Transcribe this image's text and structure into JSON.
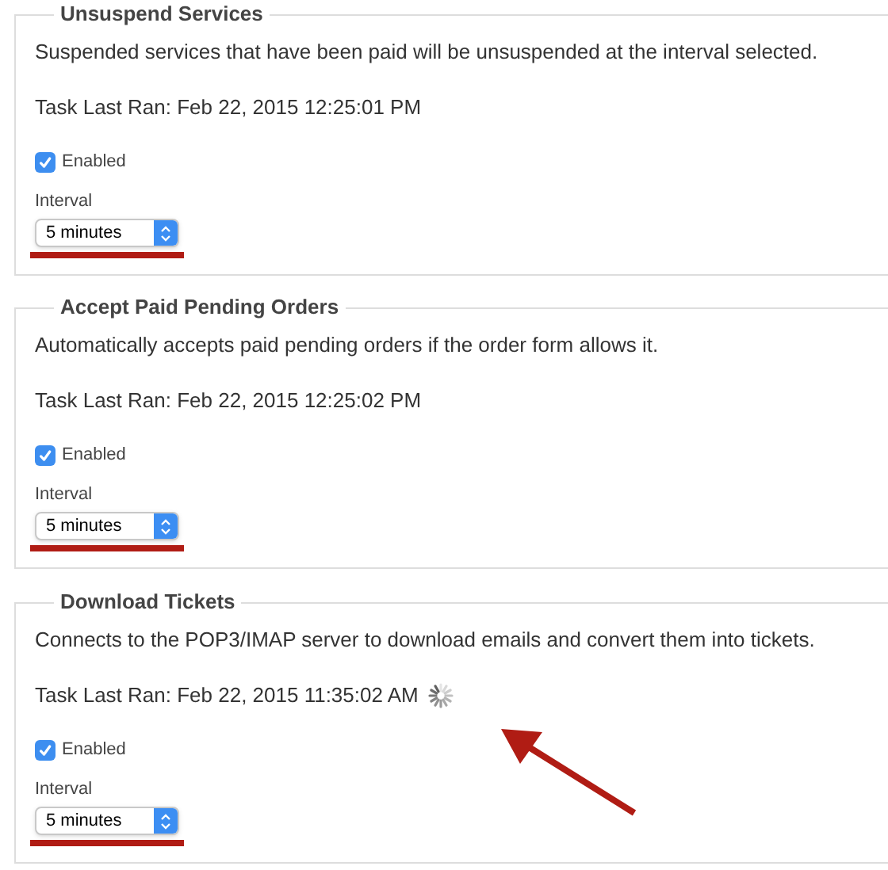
{
  "sections": [
    {
      "title": "Unsuspend Services",
      "description": "Suspended services that have been paid will be unsuspended at the interval selected.",
      "task_last_ran": "Task Last Ran: Feb 22, 2015 12:25:01 PM",
      "loading": false,
      "pointer_arrow": false,
      "enabled": {
        "label": "Enabled",
        "checked": true
      },
      "interval": {
        "label": "Interval",
        "value": "5 minutes",
        "underlined": true
      }
    },
    {
      "title": "Accept Paid Pending Orders",
      "description": "Automatically accepts paid pending orders if the order form allows it.",
      "task_last_ran": "Task Last Ran: Feb 22, 2015 12:25:02 PM",
      "loading": false,
      "pointer_arrow": false,
      "enabled": {
        "label": "Enabled",
        "checked": true
      },
      "interval": {
        "label": "Interval",
        "value": "5 minutes",
        "underlined": true
      }
    },
    {
      "title": "Download Tickets",
      "description": "Connects to the POP3/IMAP server to download emails and convert them into tickets.",
      "task_last_ran": "Task Last Ran: Feb 22, 2015 11:35:02 AM",
      "loading": true,
      "pointer_arrow": true,
      "enabled": {
        "label": "Enabled",
        "checked": true
      },
      "interval": {
        "label": "Interval",
        "value": "5 minutes",
        "underlined": true
      }
    }
  ]
}
